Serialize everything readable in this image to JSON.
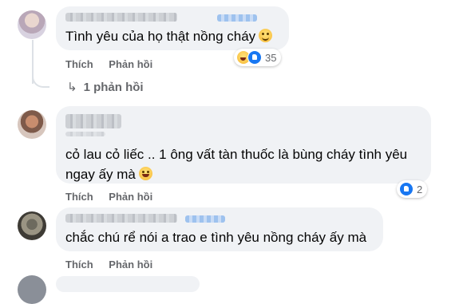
{
  "comments": [
    {
      "text": "Tình yêu của họ thật nồng cháy",
      "actions": {
        "like": "Thích",
        "reply": "Phản hồi"
      },
      "reactions": {
        "icons": [
          "haha-icon",
          "like-icon"
        ],
        "count": "35"
      },
      "replies_link": "1 phản hồi"
    },
    {
      "text_line1": "cỏ lau cỏ liếc .. 1 ông vất tàn thuốc là bùng cháy tình yêu",
      "text_line2": "ngay ấy mà",
      "actions": {
        "like": "Thích",
        "reply": "Phản hồi"
      },
      "reactions": {
        "icons": [
          "like-icon"
        ],
        "count": "2"
      }
    },
    {
      "text": "chắc chú rể nói a trao e tình yêu nồng cháy ấy mà",
      "actions": {
        "like": "Thích",
        "reply": "Phản hồi"
      }
    }
  ],
  "colors": {
    "bubble": "#f0f2f5",
    "action_text": "#65676b",
    "like_blue": "#1877f2"
  }
}
